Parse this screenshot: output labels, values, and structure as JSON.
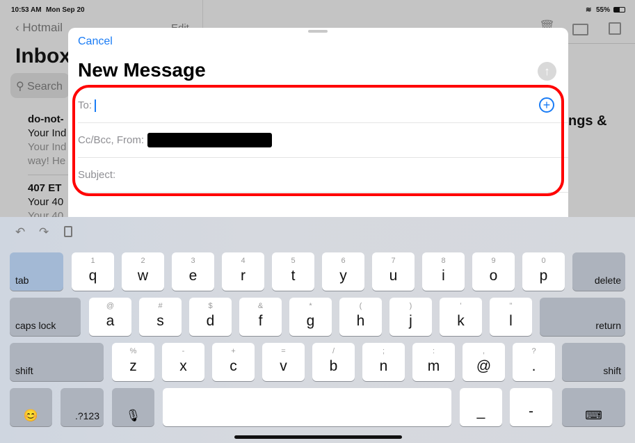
{
  "status": {
    "time": "10:53 AM",
    "date": "Mon Sep 20",
    "battery": "55%"
  },
  "background": {
    "back_label": "Hotmail",
    "edit_label": "Edit",
    "title": "Inbox",
    "search_placeholder": "Search",
    "messages": [
      {
        "sender": "do-not-",
        "subject": "Your Ind",
        "preview1": "Your Ind",
        "preview2": "way! He"
      },
      {
        "sender": "407 ET",
        "subject": "Your 40",
        "preview1": "Your 40"
      }
    ],
    "detail_text": "ngs &"
  },
  "compose": {
    "cancel": "Cancel",
    "title": "New Message",
    "to_label": "To:",
    "ccbcc_label": "Cc/Bcc, From:",
    "subject_label": "Subject:",
    "accent": "#1a7cf5",
    "highlight": "#ff0000"
  },
  "keyboard": {
    "rows": [
      [
        {
          "l": "tab",
          "t": "tab"
        },
        {
          "p": "q",
          "s": "1"
        },
        {
          "p": "w",
          "s": "2"
        },
        {
          "p": "e",
          "s": "3"
        },
        {
          "p": "r",
          "s": "4"
        },
        {
          "p": "t",
          "s": "5"
        },
        {
          "p": "y",
          "s": "6"
        },
        {
          "p": "u",
          "s": "7"
        },
        {
          "p": "i",
          "s": "8"
        },
        {
          "p": "o",
          "s": "9"
        },
        {
          "p": "p",
          "s": "0"
        },
        {
          "l": "delete",
          "t": "fn"
        }
      ],
      [
        {
          "l": "caps lock",
          "t": "fn"
        },
        {
          "p": "a",
          "s": "@"
        },
        {
          "p": "s",
          "s": "#"
        },
        {
          "p": "d",
          "s": "$"
        },
        {
          "p": "f",
          "s": "&"
        },
        {
          "p": "g",
          "s": "*"
        },
        {
          "p": "h",
          "s": "("
        },
        {
          "p": "j",
          "s": ")"
        },
        {
          "p": "k",
          "s": "'"
        },
        {
          "p": "l",
          "s": "\""
        },
        {
          "l": "return",
          "t": "fn"
        }
      ],
      [
        {
          "l": "shift",
          "t": "fn"
        },
        {
          "p": "z",
          "s": "%"
        },
        {
          "p": "x",
          "s": "-"
        },
        {
          "p": "c",
          "s": "+"
        },
        {
          "p": "v",
          "s": "="
        },
        {
          "p": "b",
          "s": "/"
        },
        {
          "p": "n",
          "s": ";"
        },
        {
          "p": "m",
          "s": ":"
        },
        {
          "p": "@",
          "s": ","
        },
        {
          "p": ".",
          "s": "?"
        },
        {
          "l": "shift",
          "t": "fn"
        }
      ],
      [
        {
          "i": "😊",
          "t": "fn",
          "n": "emoji"
        },
        {
          "l": ".?123",
          "t": "fn"
        },
        {
          "i": "🎙",
          "t": "fn",
          "n": "microphone"
        },
        {
          "p": "",
          "n": "space"
        },
        {
          "p": "_"
        },
        {
          "p": "-"
        },
        {
          "i": "⌨",
          "t": "fn",
          "n": "dismiss-keyboard"
        }
      ]
    ]
  }
}
